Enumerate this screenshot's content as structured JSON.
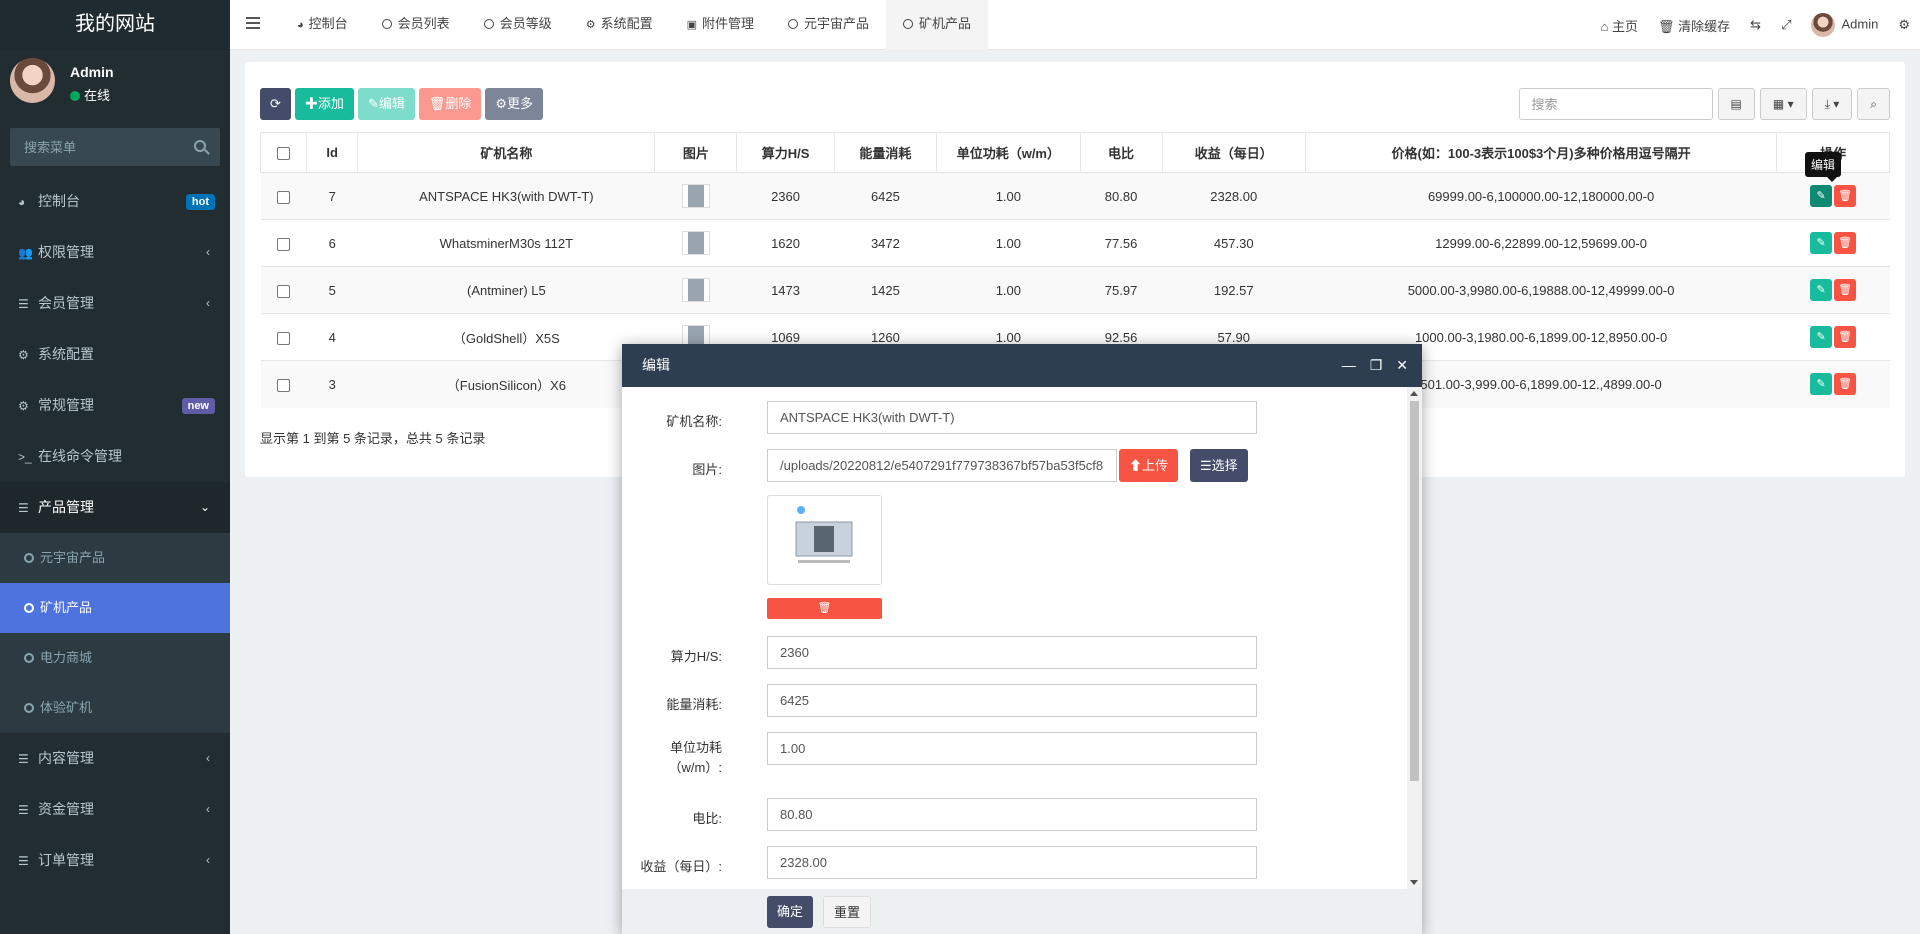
{
  "site": {
    "logo_text": "我的网站"
  },
  "user": {
    "name": "Admin",
    "status": "在线"
  },
  "sidebar": {
    "search_placeholder": "搜索菜单",
    "items": [
      {
        "label": "控制台",
        "icon": "dashboard-icon",
        "badge": "hot",
        "badge_color": "#0073b7"
      },
      {
        "label": "权限管理",
        "icon": "users-icon"
      },
      {
        "label": "会员管理",
        "icon": "list-icon"
      },
      {
        "label": "系统配置",
        "icon": "gear-icon"
      },
      {
        "label": "常规管理",
        "icon": "cogs-icon",
        "badge": "new",
        "badge_color": "#605ca8"
      },
      {
        "label": "在线命令管理",
        "icon": "terminal-icon"
      },
      {
        "label": "产品管理",
        "icon": "list-icon"
      },
      {
        "label": "内容管理",
        "icon": "list-icon"
      },
      {
        "label": "资金管理",
        "icon": "list-icon"
      },
      {
        "label": "订单管理",
        "icon": "list-icon"
      }
    ],
    "sub_items": [
      {
        "label": "元宇宙产品"
      },
      {
        "label": "矿机产品"
      },
      {
        "label": "电力商城"
      },
      {
        "label": "体验矿机"
      }
    ]
  },
  "tabs": [
    {
      "label": "控制台",
      "icon": "dashboard-icon"
    },
    {
      "label": "会员列表",
      "icon": "circle-icon"
    },
    {
      "label": "会员等级",
      "icon": "circle-icon"
    },
    {
      "label": "系统配置",
      "icon": "gear-icon"
    },
    {
      "label": "附件管理",
      "icon": "file-image-icon"
    },
    {
      "label": "元宇宙产品",
      "icon": "circle-icon"
    },
    {
      "label": "矿机产品",
      "icon": "circle-icon"
    }
  ],
  "topright": {
    "home": "主页",
    "clear_cache": "清除缓存",
    "admin": "Admin"
  },
  "toolbar": {
    "add": "添加",
    "edit": "编辑",
    "delete": "删除",
    "more": "更多",
    "search_placeholder": "搜索"
  },
  "table": {
    "headers": [
      "Id",
      "矿机名称",
      "图片",
      "算力H/S",
      "能量消耗",
      "单位功耗（w/m）",
      "电比",
      "收益（每日）",
      "价格(如：100-3表示100$3个月)多种价格用逗号隔开",
      "操作"
    ],
    "rows": [
      {
        "id": "7",
        "name": "ANTSPACE HK3(with DWT-T)",
        "hash": "2360",
        "energy": "6425",
        "unit": "1.00",
        "ratio": "80.80",
        "income": "2328.00",
        "price": "69999.00-6,100000.00-12,180000.00-0"
      },
      {
        "id": "6",
        "name": "WhatsminerM30s 112T",
        "hash": "1620",
        "energy": "3472",
        "unit": "1.00",
        "ratio": "77.56",
        "income": "457.30",
        "price": "12999.00-6,22899.00-12,59699.00-0"
      },
      {
        "id": "5",
        "name": "(Antminer) L5",
        "hash": "1473",
        "energy": "1425",
        "unit": "1.00",
        "ratio": "75.97",
        "income": "192.57",
        "price": "5000.00-3,9980.00-6,19888.00-12,49999.00-0"
      },
      {
        "id": "4",
        "name": "（GoldShell）X5S",
        "hash": "1069",
        "energy": "1260",
        "unit": "1.00",
        "ratio": "92.56",
        "income": "57.90",
        "price": "1000.00-3,1980.00-6,1899.00-12,8950.00-0"
      },
      {
        "id": "3",
        "name": "（FusionSilicon）X6",
        "hash": "",
        "energy": "",
        "unit": "",
        "ratio": "",
        "income": "",
        "price": "501.00-3,999.00-6,1899.00-12.,4899.00-0"
      }
    ],
    "tooltip": "编辑",
    "page_info": "显示第 1 到第 5 条记录，总共 5 条记录"
  },
  "modal": {
    "title": "编辑",
    "fields": {
      "name_label": "矿机名称:",
      "name_value": "ANTSPACE HK3(with DWT-T)",
      "image_label": "图片:",
      "image_value": "/uploads/20220812/e5407291f779738367bf57ba53f5cf8",
      "upload": "上传",
      "choose": "选择",
      "hash_label": "算力H/S:",
      "hash_value": "2360",
      "energy_label": "能量消耗:",
      "energy_value": "6425",
      "unit_label": "单位功耗（w/m）:",
      "unit_value": "1.00",
      "ratio_label": "电比:",
      "ratio_value": "80.80",
      "income_label": "收益（每日）:",
      "income_value": "2328.00"
    },
    "confirm": "确定",
    "reset": "重置"
  },
  "colors": {
    "primary": "#3c8dbc",
    "success": "#18bc9c",
    "danger": "#f75444",
    "dark": "#2c3e50",
    "sidebar": "#222d32"
  }
}
